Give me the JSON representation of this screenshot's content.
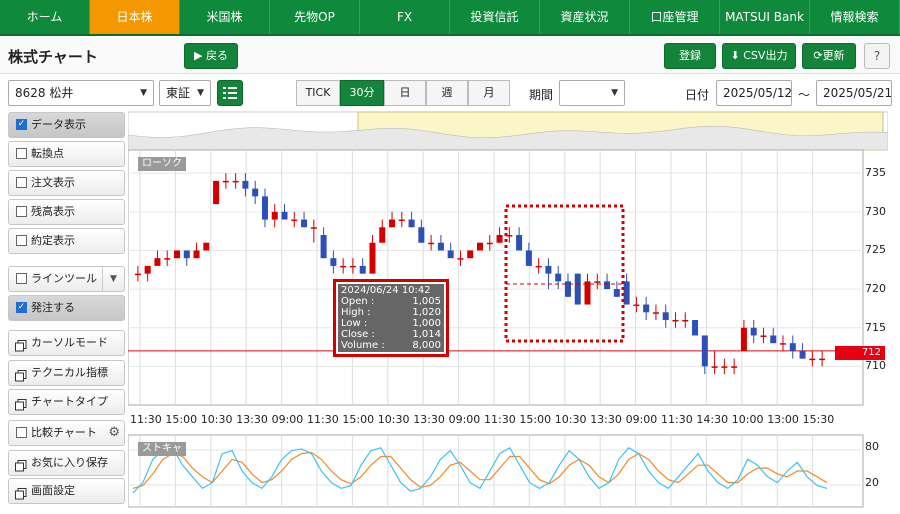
{
  "nav": [
    "ホーム",
    "日本株",
    "米国株",
    "先物OP",
    "FX",
    "投資信託",
    "資産状況",
    "口座管理",
    "MATSUI Bank",
    "情報検索"
  ],
  "header": {
    "title": "株式チャート",
    "back": "▶ 戻る",
    "register": "登録",
    "csv": "CSV出力",
    "refresh": "更新",
    "help": "?"
  },
  "toolbar": {
    "stock": "8628 松井",
    "market": "東証",
    "periods": [
      "TICK",
      "30分",
      "日",
      "週",
      "月"
    ],
    "active_period": "30分",
    "period_label": "期間",
    "date_label": "日付",
    "date_from": "2025/05/12",
    "tilde": "〜",
    "date_to": "2025/05/21"
  },
  "sidebar": [
    {
      "label": "データ表示",
      "checked": true
    },
    {
      "label": "転換点",
      "checked": false
    },
    {
      "label": "注文表示",
      "checked": false
    },
    {
      "label": "残高表示",
      "checked": false
    },
    {
      "label": "約定表示",
      "checked": false
    },
    {
      "label": "ラインツール",
      "checked": false
    },
    {
      "label": "発注する",
      "checked": true
    },
    {
      "label": "カーソルモード"
    },
    {
      "label": "テクニカル指標"
    },
    {
      "label": "チャートタイプ"
    },
    {
      "label": "比較チャート",
      "checked": false
    },
    {
      "label": "お気に入り保存"
    },
    {
      "label": "画面設定"
    }
  ],
  "chart": {
    "candle_tag": "ローソク",
    "stoch_tag": "ストキャ",
    "yticks": [
      "735",
      "730",
      "725",
      "720",
      "715",
      "710"
    ],
    "xticks": [
      "11:30",
      "15:00",
      "10:30",
      "13:30",
      "09:00",
      "11:30",
      "15:00",
      "10:30",
      "13:30",
      "09:00",
      "11:30",
      "15:00",
      "10:30",
      "13:30",
      "09:00",
      "11:30",
      "14:30",
      "10:00",
      "13:00",
      "15:30"
    ],
    "stoch_ticks": [
      "80",
      "20"
    ],
    "current_price": "712",
    "tooltip": {
      "date": "2024/06/24 10:42",
      "rows": [
        [
          "Open :",
          "1,005"
        ],
        [
          "High :",
          "1,020"
        ],
        [
          "Low :",
          "1,000"
        ],
        [
          "Close :",
          "1,014"
        ],
        [
          "Volume :",
          "8,000"
        ]
      ]
    }
  },
  "chart_data": {
    "type": "candlestick",
    "ylim": [
      705,
      738
    ],
    "up_color": "#d40000",
    "down_color": "#2d4fb8",
    "ohlc": [
      [
        722,
        723,
        721,
        722
      ],
      [
        722,
        723,
        721,
        723
      ],
      [
        723,
        725,
        723,
        724
      ],
      [
        724,
        725,
        723,
        724
      ],
      [
        724,
        725,
        724,
        725
      ],
      [
        725,
        725,
        723,
        724
      ],
      [
        724,
        726,
        724,
        725
      ],
      [
        725,
        726,
        725,
        726
      ],
      [
        731,
        734,
        731,
        734
      ],
      [
        734,
        735,
        733,
        734
      ],
      [
        734,
        735,
        733,
        734
      ],
      [
        734,
        735,
        732,
        733
      ],
      [
        733,
        734,
        731,
        732
      ],
      [
        732,
        733,
        728,
        729
      ],
      [
        729,
        731,
        728,
        730
      ],
      [
        730,
        731,
        729,
        729
      ],
      [
        729,
        730,
        728,
        729
      ],
      [
        729,
        730,
        728,
        728
      ],
      [
        728,
        729,
        726,
        728
      ],
      [
        727,
        728,
        724,
        724
      ],
      [
        724,
        725,
        722,
        723
      ],
      [
        723,
        724,
        722,
        723
      ],
      [
        723,
        724,
        722,
        723
      ],
      [
        723,
        724,
        722,
        722
      ],
      [
        722,
        727,
        722,
        726
      ],
      [
        726,
        729,
        726,
        728
      ],
      [
        728,
        730,
        728,
        729
      ],
      [
        729,
        730,
        728,
        729
      ],
      [
        729,
        730,
        728,
        728
      ],
      [
        728,
        729,
        726,
        726
      ],
      [
        726,
        727,
        725,
        726
      ],
      [
        726,
        727,
        725,
        725
      ],
      [
        725,
        726,
        724,
        724
      ],
      [
        724,
        725,
        723,
        724
      ],
      [
        724,
        725,
        724,
        725
      ],
      [
        725,
        726,
        725,
        726
      ],
      [
        726,
        727,
        725,
        726
      ],
      [
        726,
        728,
        726,
        727
      ],
      [
        727,
        728,
        726,
        727
      ],
      [
        727,
        728,
        725,
        725
      ],
      [
        725,
        726,
        723,
        723
      ],
      [
        723,
        724,
        722,
        723
      ],
      [
        723,
        724,
        720,
        722
      ],
      [
        722,
        723,
        720,
        721
      ],
      [
        721,
        722,
        719,
        719
      ],
      [
        722,
        721,
        718,
        718
      ],
      [
        718,
        722,
        718,
        721
      ],
      [
        721,
        722,
        720,
        721
      ],
      [
        721,
        722,
        720,
        720
      ],
      [
        720,
        721,
        719,
        719
      ],
      [
        721,
        722,
        718,
        718
      ],
      [
        718,
        719,
        717,
        718
      ],
      [
        718,
        719,
        716,
        717
      ],
      [
        717,
        718,
        716,
        717
      ],
      [
        717,
        718,
        715,
        716
      ],
      [
        716,
        717,
        715,
        716
      ],
      [
        716,
        717,
        715,
        716
      ],
      [
        716,
        716,
        714,
        714
      ],
      [
        714,
        714,
        709,
        710
      ],
      [
        710,
        712,
        709,
        710
      ],
      [
        710,
        711,
        709,
        710
      ],
      [
        710,
        711,
        709,
        710
      ],
      [
        712,
        716,
        712,
        715
      ],
      [
        715,
        716,
        713,
        714
      ],
      [
        714,
        715,
        713,
        714
      ],
      [
        714,
        715,
        713,
        713
      ],
      [
        713,
        714,
        712,
        713
      ],
      [
        713,
        714,
        711,
        712
      ],
      [
        712,
        713,
        711,
        711
      ],
      [
        711,
        712,
        710,
        711
      ],
      [
        711,
        712,
        710,
        711
      ]
    ],
    "stoch_k": [
      12,
      30,
      70,
      85,
      90,
      60,
      40,
      20,
      30,
      80,
      85,
      50,
      30,
      20,
      40,
      70,
      85,
      88,
      80,
      50,
      30,
      20,
      25,
      60,
      85,
      90,
      60,
      30,
      15,
      20,
      40,
      70,
      85,
      60,
      30,
      20,
      50,
      80,
      90,
      60,
      30,
      20,
      30,
      60,
      85,
      70,
      40,
      20,
      30,
      70,
      90,
      80,
      50,
      30,
      20,
      40,
      60,
      80,
      50,
      30,
      20,
      35,
      70,
      60,
      40,
      30,
      50,
      65,
      40,
      25,
      20
    ],
    "stoch_d": [
      20,
      25,
      45,
      70,
      80,
      75,
      55,
      40,
      30,
      50,
      70,
      65,
      45,
      30,
      35,
      50,
      70,
      80,
      82,
      70,
      50,
      35,
      28,
      40,
      60,
      75,
      75,
      55,
      35,
      22,
      25,
      40,
      60,
      65,
      50,
      35,
      35,
      55,
      75,
      75,
      55,
      35,
      28,
      40,
      60,
      70,
      60,
      40,
      30,
      45,
      70,
      80,
      70,
      50,
      35,
      30,
      45,
      60,
      60,
      45,
      30,
      30,
      45,
      55,
      55,
      45,
      40,
      50,
      50,
      40,
      30
    ]
  }
}
